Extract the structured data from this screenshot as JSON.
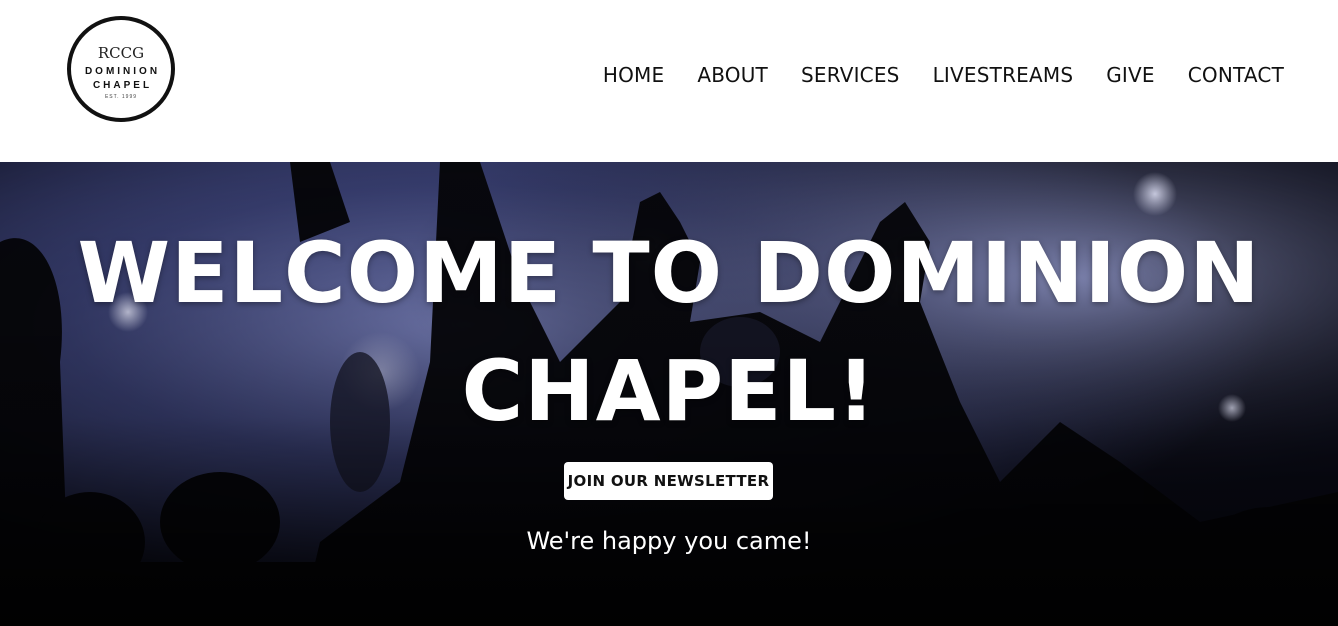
{
  "logo": {
    "top_text": "RCCG",
    "line1": "DOMINION",
    "line2": "CHAPEL",
    "est": "EST. 1999"
  },
  "nav": {
    "items": [
      {
        "label": "HOME"
      },
      {
        "label": "ABOUT"
      },
      {
        "label": "SERVICES"
      },
      {
        "label": "LIVESTREAMS"
      },
      {
        "label": "GIVE"
      },
      {
        "label": "CONTACT"
      }
    ]
  },
  "hero": {
    "title": "WELCOME TO DOMINION CHAPEL!",
    "newsletter_label": "JOIN OUR NEWSLETTER",
    "tagline": "We're happy you came!"
  },
  "colors": {
    "header_bg": "#ffffff",
    "text_dark": "#111111",
    "hero_tint": "#5a63a8",
    "hero_dark": "#0a0a14",
    "button_bg": "#ffffff"
  }
}
